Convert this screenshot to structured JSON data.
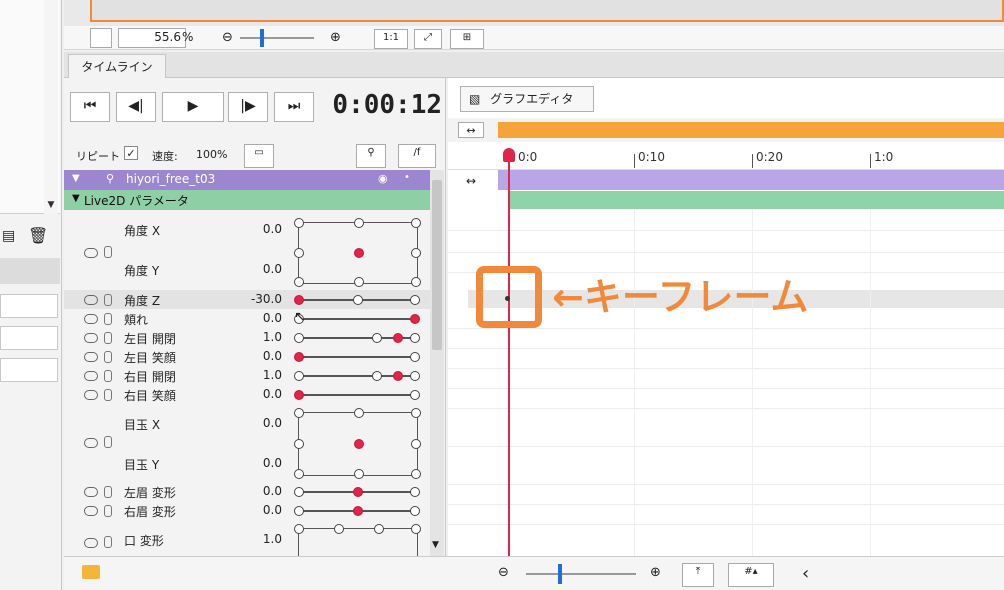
{
  "viewer": {
    "zoom_value": "55.6",
    "zoom_unit": "%",
    "zoom_out_icon": "zoom-out-icon",
    "zoom_in_icon": "zoom-in-icon",
    "one_to_one_label": "1:1"
  },
  "tabs": {
    "timeline": "タイムライン"
  },
  "playback": {
    "buttons": [
      "to-start-icon",
      "prev-frame-icon",
      "play-icon",
      "next-frame-icon",
      "to-end-icon"
    ],
    "timecode": "0:00:12"
  },
  "repeat": {
    "label": "リピート",
    "checked": true,
    "speed_label": "速度:",
    "speed_value": "100%"
  },
  "track": {
    "name": "hiyori_free_t03"
  },
  "group": {
    "name": "Live2D パラメータ"
  },
  "params": [
    {
      "name": "角度 X",
      "value": "0.0"
    },
    {
      "name": "角度 Y",
      "value": "0.0"
    },
    {
      "name": "角度 Z",
      "value": "-30.0"
    },
    {
      "name": "頬れ",
      "value": "0.0"
    },
    {
      "name": "左目 開閉",
      "value": "1.0"
    },
    {
      "name": "左目 笑顔",
      "value": "0.0"
    },
    {
      "name": "右目 開閉",
      "value": "1.0"
    },
    {
      "name": "右目 笑顔",
      "value": "0.0"
    },
    {
      "name": "目玉 X",
      "value": "0.0"
    },
    {
      "name": "目玉 Y",
      "value": "0.0"
    },
    {
      "name": "左眉 変形",
      "value": "0.0"
    },
    {
      "name": "右眉 変形",
      "value": "0.0"
    },
    {
      "name": "口 変形",
      "value": "1.0"
    }
  ],
  "graph_editor": {
    "label": "グラフエディタ"
  },
  "ruler": {
    "ticks": [
      "0:0",
      "0:10",
      "0:20",
      "1:0"
    ]
  },
  "annotation": {
    "label": "←キーフレーム"
  },
  "colors": {
    "accent": "#f08a3a",
    "playhead": "#e0244a",
    "track": "#9a87cf",
    "group": "#8fcfa6"
  }
}
